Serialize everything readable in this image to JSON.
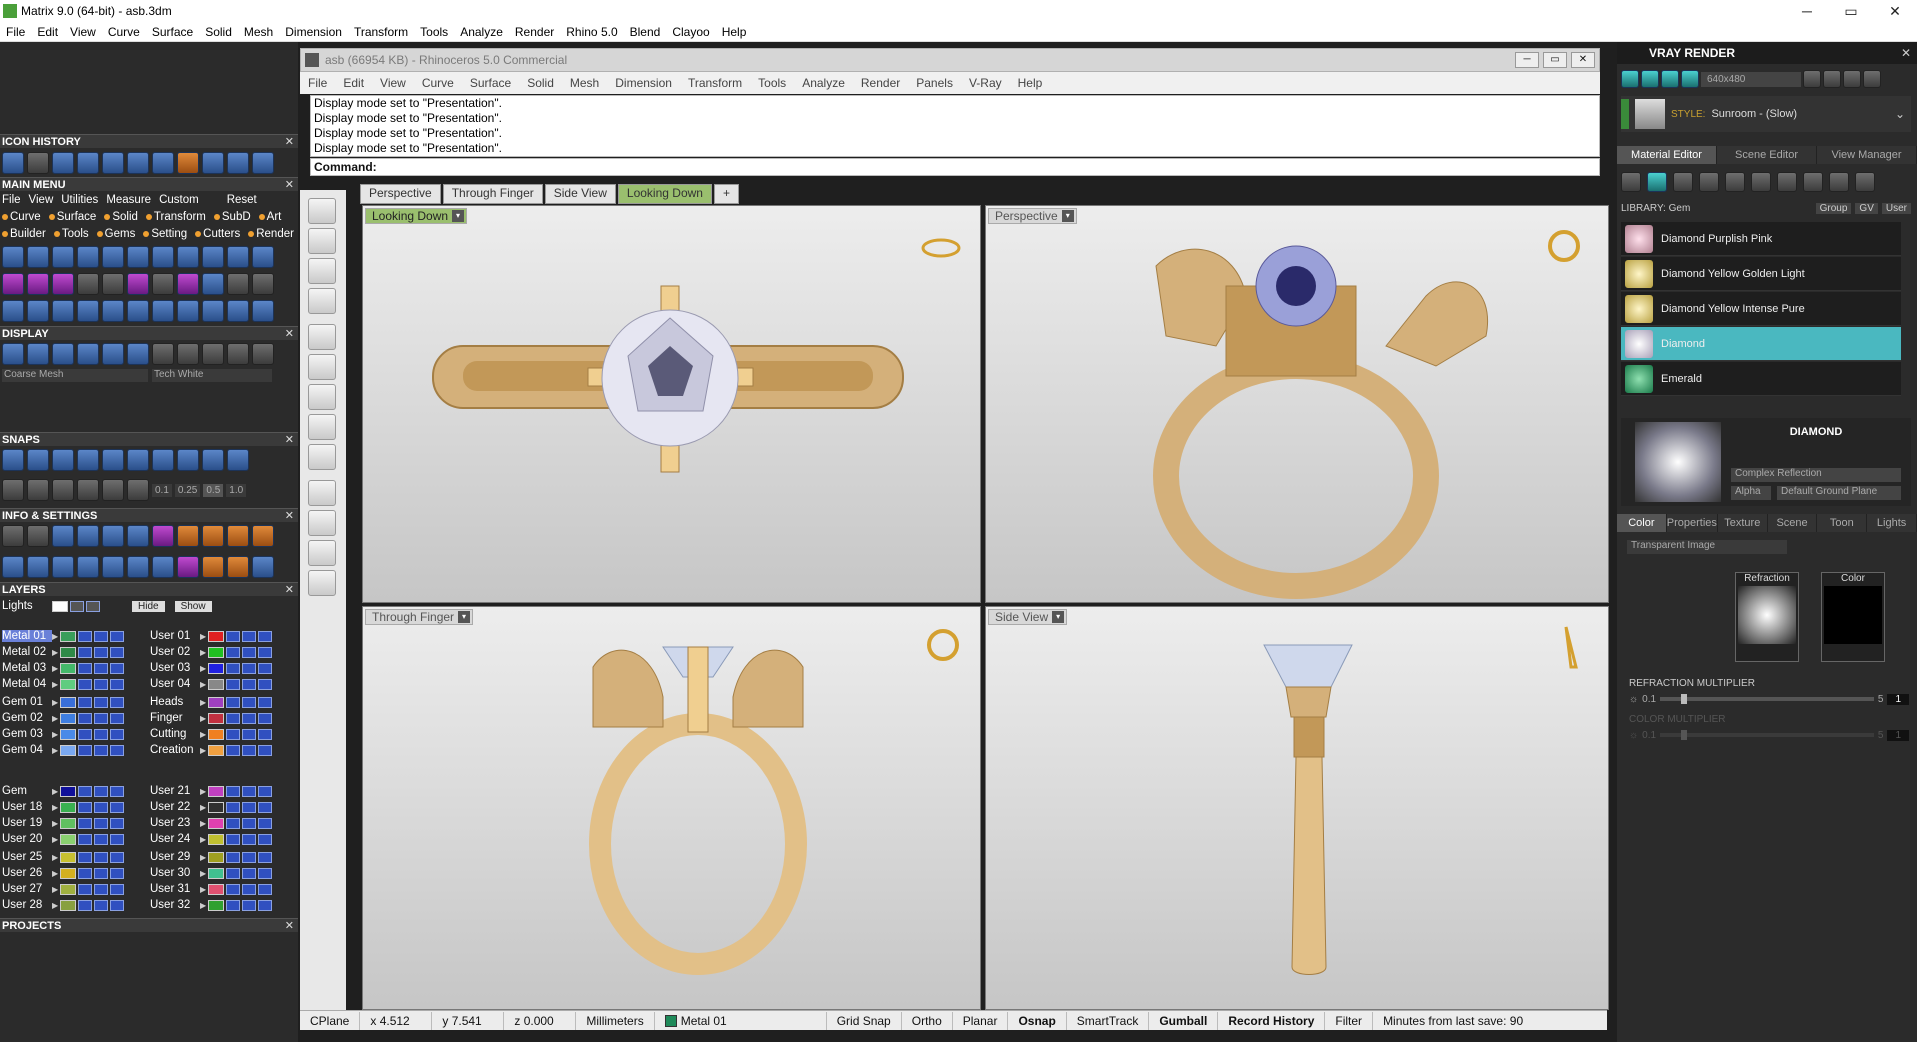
{
  "app": {
    "title": "Matrix 9.0 (64-bit) - asb.3dm",
    "menu": [
      "File",
      "Edit",
      "View",
      "Curve",
      "Surface",
      "Solid",
      "Mesh",
      "Dimension",
      "Transform",
      "Tools",
      "Analyze",
      "Render",
      "Rhino 5.0",
      "Blend",
      "Clayoo",
      "Help"
    ],
    "window_controls": [
      "─",
      "▭",
      "✕"
    ]
  },
  "left": {
    "icon_history": "ICON HISTORY",
    "main_menu": "MAIN MENU",
    "main_menu_row1": [
      "File",
      "View",
      "Utilities",
      "Measure",
      "Custom",
      "Reset"
    ],
    "main_menu_row2": [
      "Curve",
      "Surface",
      "Solid",
      "Transform",
      "SubD",
      "Art"
    ],
    "main_menu_row3": [
      "Builder",
      "Tools",
      "Gems",
      "Setting",
      "Cutters",
      "Render"
    ],
    "display": "DISPLAY",
    "display_mesh": "Coarse Mesh",
    "display_color": "Tech White",
    "snaps": "SNAPS",
    "snap_values": [
      "0.1",
      "0.25",
      "0.5",
      "1.0"
    ],
    "info": "INFO & SETTINGS",
    "layers": "LAYERS",
    "lights": "Lights",
    "hide": "Hide",
    "show": "Show",
    "layers_left": [
      {
        "name": "Metal 01",
        "color": "#3a9e5a"
      },
      {
        "name": "Metal 02",
        "color": "#2f8a48"
      },
      {
        "name": "Metal 03",
        "color": "#44b86a"
      },
      {
        "name": "Metal 04",
        "color": "#5fcc80"
      },
      {
        "name": "Gem 01",
        "color": "#3a6fd8"
      },
      {
        "name": "Gem 02",
        "color": "#3f7ee0"
      },
      {
        "name": "Gem 03",
        "color": "#4a8ae8"
      },
      {
        "name": "Gem 04",
        "color": "#7aa8f0"
      },
      {
        "name": "Gem",
        "color": "#10109a"
      },
      {
        "name": "User 18",
        "color": "#3ab050"
      },
      {
        "name": "User 19",
        "color": "#60c060"
      },
      {
        "name": "User 20",
        "color": "#8ad070"
      },
      {
        "name": "User 25",
        "color": "#c8c030"
      },
      {
        "name": "User 26",
        "color": "#d4b020"
      },
      {
        "name": "User 27",
        "color": "#a0b040"
      },
      {
        "name": "User 28",
        "color": "#88a040"
      }
    ],
    "layers_right": [
      {
        "name": "User 01",
        "color": "#e02020"
      },
      {
        "name": "User 02",
        "color": "#20c020"
      },
      {
        "name": "User 03",
        "color": "#2020e0"
      },
      {
        "name": "User 04",
        "color": "#888888"
      },
      {
        "name": "Heads",
        "color": "#a040c0"
      },
      {
        "name": "Finger",
        "color": "#c03040"
      },
      {
        "name": "Cutting",
        "color": "#f08020"
      },
      {
        "name": "Creation",
        "color": "#f0a040"
      },
      {
        "name": "User 21",
        "color": "#c040c0"
      },
      {
        "name": "User 22",
        "color": "#303030"
      },
      {
        "name": "User 23",
        "color": "#e040b0"
      },
      {
        "name": "User 24",
        "color": "#c0c030"
      },
      {
        "name": "User 29",
        "color": "#a0a020"
      },
      {
        "name": "User 30",
        "color": "#40c090"
      },
      {
        "name": "User 31",
        "color": "#e05070"
      },
      {
        "name": "User 32",
        "color": "#30a030"
      }
    ],
    "projects": "PROJECTS"
  },
  "rhino": {
    "title": "asb (66954 KB) - Rhinoceros 5.0 Commercial",
    "menu": [
      "File",
      "Edit",
      "View",
      "Curve",
      "Surface",
      "Solid",
      "Mesh",
      "Dimension",
      "Transform",
      "Tools",
      "Analyze",
      "Render",
      "Panels",
      "V-Ray",
      "Help"
    ],
    "history": [
      "Display mode set to \"Presentation\".",
      "Display mode set to \"Presentation\".",
      "Display mode set to \"Presentation\".",
      "Display mode set to \"Presentation\"."
    ],
    "command_label": "Command:",
    "tabs": [
      "Perspective",
      "Through Finger",
      "Side View",
      "Looking Down"
    ],
    "active_tab": "Looking Down",
    "viewports": {
      "tl": "Looking Down",
      "tr": "Perspective",
      "bl": "Through Finger",
      "br": "Side View"
    }
  },
  "status": {
    "cplane": "CPlane",
    "x": "x 4.512",
    "y": "y 7.541",
    "z": "z 0.000",
    "units": "Millimeters",
    "layer": "Metal 01",
    "layer_color": "#1f8a5a",
    "items": [
      "Grid Snap",
      "Ortho",
      "Planar",
      "Osnap",
      "SmartTrack",
      "Gumball",
      "Record History",
      "Filter"
    ],
    "bold_items": [
      "Osnap",
      "Gumball",
      "Record History"
    ],
    "minutes": "Minutes from last save: 90"
  },
  "vray": {
    "title": "VRAY RENDER",
    "resolution": "640x480",
    "style_label": "STYLE:",
    "style_value": "Sunroom - (Slow)",
    "tabs1": [
      "Material Editor",
      "Scene Editor",
      "View Manager"
    ],
    "library_label": "LIBRARY: Gem",
    "group_label": "Group",
    "gv_label": "GV",
    "user_label": "User",
    "library": [
      "Diamond Purplish Pink",
      "Diamond Yellow Golden Light",
      "Diamond Yellow Intense Pure",
      "Diamond",
      "Emerald"
    ],
    "selected": "Diamond",
    "material_name": "DIAMOND",
    "reflection_mode": "Complex Reflection",
    "alpha_label": "Alpha",
    "ground_plane": "Default Ground Plane",
    "tabs2": [
      "Color",
      "Properties",
      "Texture",
      "Scene",
      "Toon",
      "Lights"
    ],
    "image_mode": "Transparent Image",
    "refraction_label": "Refraction",
    "color_label": "Color",
    "refraction_multiplier": "REFRACTION MULTIPLIER",
    "refr_min": "0.1",
    "refr_max": "5",
    "refr_val": "1",
    "color_multiplier": "COLOR MULTIPLIER",
    "col_min": "0.1",
    "col_max": "5",
    "col_val": "1"
  }
}
